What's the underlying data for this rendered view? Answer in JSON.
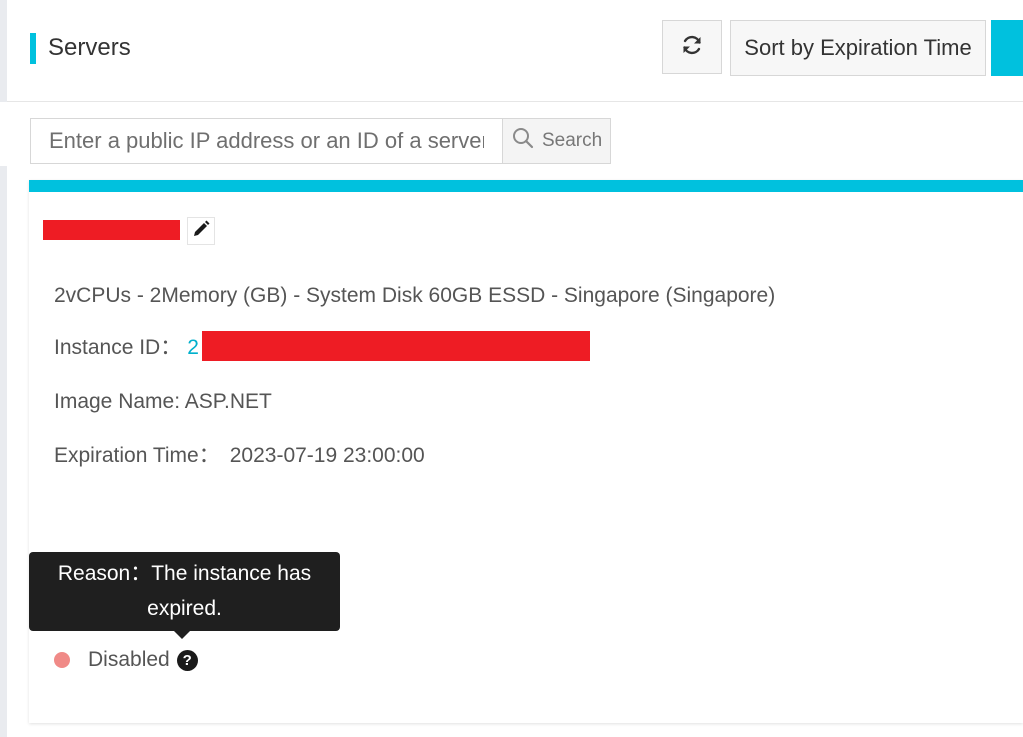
{
  "header": {
    "title": "Servers",
    "refresh_icon": "refresh-icon",
    "sort_label": "Sort by Expiration Time",
    "accent_color": "#00c1de"
  },
  "search": {
    "placeholder": "Enter a public IP address or an ID of a server",
    "button_label": "Search",
    "button_icon": "search-icon"
  },
  "server": {
    "name_redacted": true,
    "edit_icon": "pencil-icon",
    "spec": "2vCPUs - 2Memory (GB) - System Disk 60GB ESSD - Singapore (Singapore)",
    "instance_id_label": "Instance ID：",
    "instance_id_visible": "2",
    "image_name": "Image Name: ASP.NET",
    "expiration_label": "Expiration Time：",
    "expiration_value": "2023-07-19 23:00:00",
    "tooltip_line1": "Reason：The instance has",
    "tooltip_line2": "expired.",
    "status_label": "Disabled",
    "status_color": "#f08a87",
    "help_icon": "question-circle-icon",
    "redaction_color": "#ee1c24"
  }
}
